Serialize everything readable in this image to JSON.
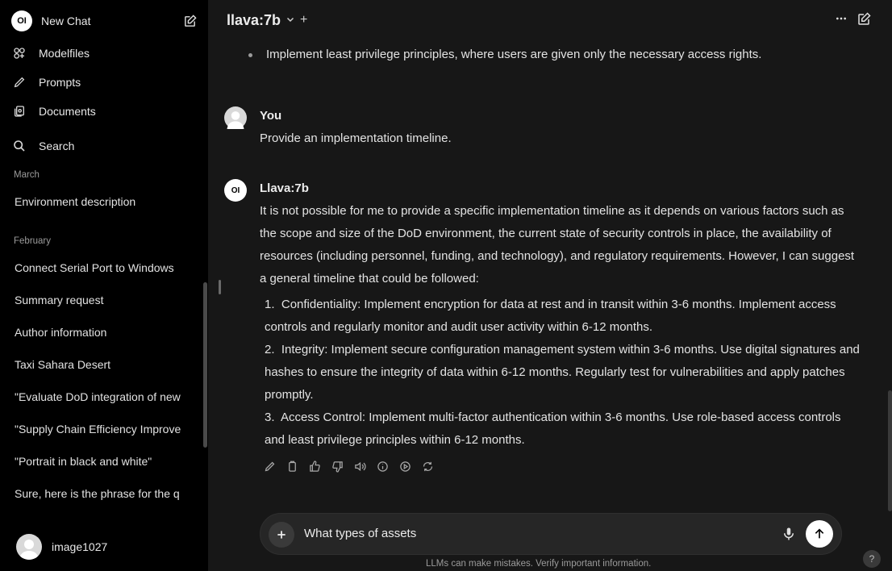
{
  "sidebar": {
    "new_chat": "New Chat",
    "nav": [
      {
        "label": "Modelfiles",
        "icon": "modelfiles-icon"
      },
      {
        "label": "Prompts",
        "icon": "pencil-icon"
      },
      {
        "label": "Documents",
        "icon": "documents-icon"
      }
    ],
    "search": "Search",
    "sections": [
      {
        "title": "March",
        "chats": [
          "Environment description"
        ]
      },
      {
        "title": "February",
        "chats": [
          "Connect Serial Port to Windows",
          "Summary request",
          "Author information",
          "Taxi Sahara Desert",
          "\"Evaluate DoD integration of new",
          "\"Supply Chain Efficiency Improve",
          "\"Portrait in black and white\"",
          "Sure, here is the phrase for the q"
        ]
      }
    ],
    "user_name": "image1027"
  },
  "header": {
    "model": "llava:7b",
    "plus": "+"
  },
  "chat": {
    "prev_bullet": "Implement least privilege principles, where users are given only the necessary access rights.",
    "user_name": "You",
    "user_message": "Provide an implementation timeline.",
    "bot_name": "Llava:7b",
    "bot_intro": "It is not possible for me to provide a specific implementation timeline as it depends on various factors such as the scope and size of the DoD environment, the current state of security controls in place, the availability of resources (including personnel, funding, and technology), and regulatory requirements. However, I can suggest a general timeline that could be followed:",
    "bot_steps": [
      {
        "num": "1.",
        "text": "Confidentiality: Implement encryption for data at rest and in transit within 3-6 months. Implement access controls and regularly monitor and audit user activity within 6-12 months."
      },
      {
        "num": "2.",
        "text": "Integrity: Implement secure configuration management system within 3-6 months. Use digital signatures and hashes to ensure the integrity of data within 6-12 months. Regularly test for vulnerabilities and apply patches promptly."
      },
      {
        "num": "3.",
        "text": "Access Control: Implement multi-factor authentication within 3-6 months. Use role-based access controls and least privilege principles within 6-12 months."
      }
    ]
  },
  "input": {
    "value": "What types of assets",
    "disclaimer": "LLMs can make mistakes. Verify important information.",
    "help": "?"
  },
  "colors": {
    "sidebar_bg": "#000000",
    "main_bg": "#171717",
    "input_bg": "#262626",
    "text": "#ececec"
  }
}
